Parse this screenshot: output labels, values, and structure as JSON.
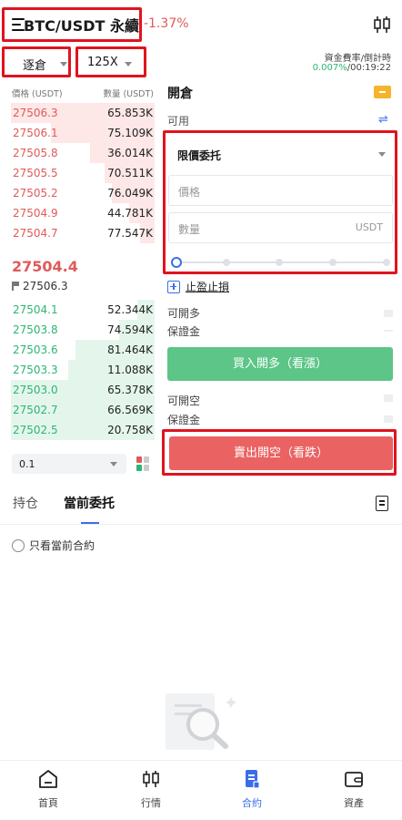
{
  "header": {
    "pair_title": "BTC/USDT 永續",
    "change": "-1.37%"
  },
  "controls": {
    "mode": "逐倉",
    "leverage": "125X",
    "funding_label": "資金費率/倒計時",
    "funding_rate": "0.007%",
    "countdown": "/00:19:22"
  },
  "orderbook": {
    "headers": {
      "price": "價格 (USDT)",
      "qty": "數量 (USDT)"
    },
    "asks": [
      {
        "price": "27506.3",
        "qty": "65.853K",
        "depth": 1.0
      },
      {
        "price": "27506.1",
        "qty": "75.109K",
        "depth": 0.72
      },
      {
        "price": "27505.8",
        "qty": "36.014K",
        "depth": 0.45
      },
      {
        "price": "27505.5",
        "qty": "70.511K",
        "depth": 0.35
      },
      {
        "price": "27505.2",
        "qty": "76.049K",
        "depth": 0.3
      },
      {
        "price": "27504.9",
        "qty": "44.781K",
        "depth": 0.18
      },
      {
        "price": "27504.7",
        "qty": "77.547K",
        "depth": 0.1
      }
    ],
    "last_price": "27504.4",
    "mark_price": "27506.3",
    "bids": [
      {
        "price": "27504.1",
        "qty": "52.344K",
        "depth": 0.12
      },
      {
        "price": "27503.8",
        "qty": "74.594K",
        "depth": 0.25
      },
      {
        "price": "27503.6",
        "qty": "81.464K",
        "depth": 0.55
      },
      {
        "price": "27503.3",
        "qty": "11.088K",
        "depth": 0.6
      },
      {
        "price": "27503.0",
        "qty": "65.378K",
        "depth": 1.0
      },
      {
        "price": "27502.7",
        "qty": "66.569K",
        "depth": 1.0
      },
      {
        "price": "27502.5",
        "qty": "20.758K",
        "depth": 1.0
      }
    ],
    "depth_step": "0.1"
  },
  "trade": {
    "open_title": "開倉",
    "available_label": "可用",
    "order_type": "限價委托",
    "price_placeholder": "價格",
    "qty_placeholder": "數量",
    "qty_unit": "USDT",
    "tpsl_label": "止盈止損",
    "can_open_long": "可開多",
    "margin_long": "保證金",
    "long_button": "買入開多（看漲）",
    "can_open_short": "可開空",
    "margin_short": "保證金",
    "short_button": "賣出開空（看跌）"
  },
  "tabs": {
    "positions": "持仓",
    "open_orders": "當前委托",
    "only_current": "只看當前合約"
  },
  "nav": [
    {
      "label": "首頁",
      "icon": "home-icon"
    },
    {
      "label": "行情",
      "icon": "candlestick-icon"
    },
    {
      "label": "合約",
      "icon": "contract-icon",
      "active": true
    },
    {
      "label": "資產",
      "icon": "wallet-icon"
    }
  ],
  "colors": {
    "up": "#2bb673",
    "down": "#e05a5a",
    "accent": "#3a6ee8"
  }
}
